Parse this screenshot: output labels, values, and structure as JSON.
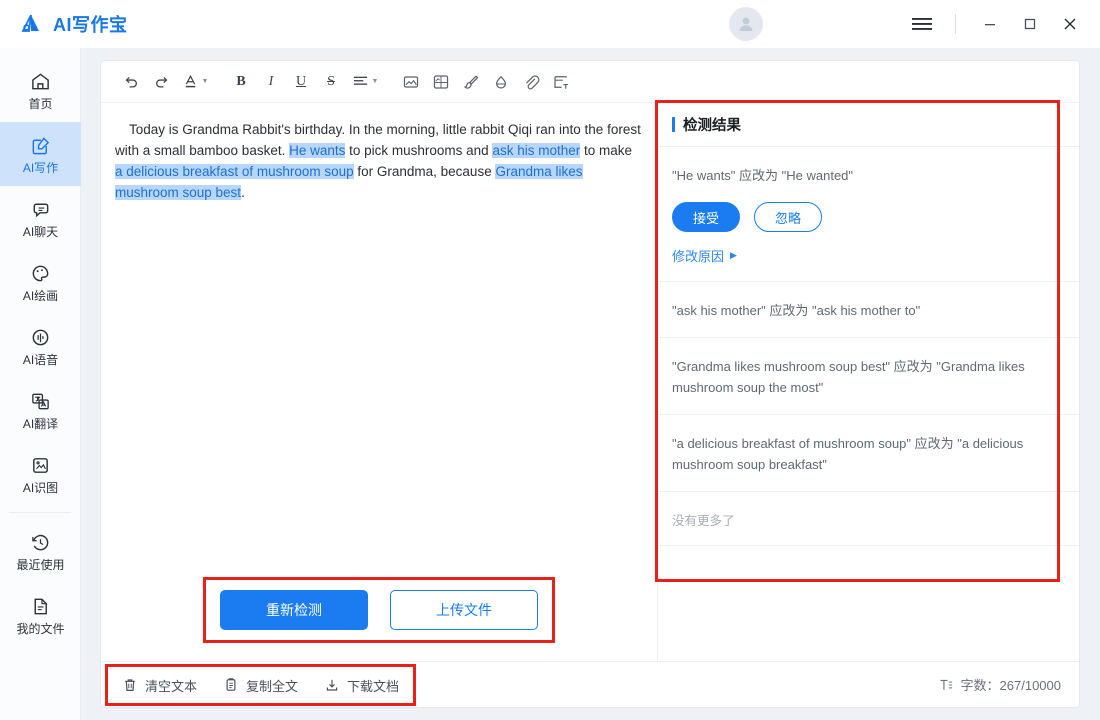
{
  "window": {
    "app_title": "AI写作宝",
    "logo_color": "#1777e8",
    "menu_icon": "hamburger-menu-icon",
    "minimize_label": "—",
    "maximize_label": "□",
    "close_label": "✕"
  },
  "sidebar": {
    "items": [
      {
        "label": "首页",
        "icon": "home-icon",
        "active": false
      },
      {
        "label": "AI写作",
        "icon": "edit-document-icon",
        "active": true
      },
      {
        "label": "AI聊天",
        "icon": "chat-bubble-icon",
        "active": false
      },
      {
        "label": "AI绘画",
        "icon": "palette-icon",
        "active": false
      },
      {
        "label": "AI语音",
        "icon": "audio-wave-icon",
        "active": false
      },
      {
        "label": "AI翻译",
        "icon": "translate-icon",
        "active": false
      },
      {
        "label": "AI识图",
        "icon": "image-recognition-icon",
        "active": false
      }
    ],
    "items_secondary": [
      {
        "label": "最近使用",
        "icon": "history-clock-icon",
        "active": false
      },
      {
        "label": "我的文件",
        "icon": "file-document-icon",
        "active": false
      }
    ]
  },
  "toolbar": {
    "items": [
      {
        "name": "undo-icon",
        "glyph": "↶"
      },
      {
        "name": "redo-icon",
        "glyph": "↷"
      },
      {
        "name": "text-color-icon",
        "glyph": "A"
      },
      {
        "name": "bold-icon",
        "glyph": "B"
      },
      {
        "name": "italic-icon",
        "glyph": "I"
      },
      {
        "name": "underline-icon",
        "glyph": "U"
      },
      {
        "name": "strikethrough-icon",
        "glyph": "S"
      },
      {
        "name": "align-icon",
        "glyph": "≡"
      },
      {
        "name": "insert-image-icon",
        "glyph": "image"
      },
      {
        "name": "image-frame-icon",
        "glyph": "image2"
      },
      {
        "name": "brush-icon",
        "glyph": "brush"
      },
      {
        "name": "ink-drop-icon",
        "glyph": "drop"
      },
      {
        "name": "attachment-icon",
        "glyph": "clip"
      },
      {
        "name": "insert-textbox-icon",
        "glyph": "textbox"
      }
    ]
  },
  "editor": {
    "segments": [
      {
        "text": "Today is Grandma Rabbit's birthday. In the morning, little rabbit Qiqi ran into the forest with a small bamboo basket. ",
        "highlight": false
      },
      {
        "text": "He wants",
        "highlight": true
      },
      {
        "text": " to pick mushrooms and ",
        "highlight": false
      },
      {
        "text": "ask his mother",
        "highlight": true
      },
      {
        "text": " to make ",
        "highlight": false
      },
      {
        "text": "a delicious breakfast of mushroom soup",
        "highlight": true
      },
      {
        "text": " for Grandma, because ",
        "highlight": false
      },
      {
        "text": "Grandma likes mushroom soup best",
        "highlight": true
      },
      {
        "text": ".",
        "highlight": false
      }
    ],
    "highlight_color": "#b6d7fb"
  },
  "actions": {
    "recheck_label": "重新检测",
    "upload_label": "上传文件"
  },
  "panel": {
    "title": "检测结果",
    "accent_color": "#1a7cf0",
    "results": [
      {
        "text": "\"He wants\" 应改为 \"He wanted\"",
        "accept_label": "接受",
        "ignore_label": "忽略",
        "reason_label": "修改原因",
        "has_buttons": true
      },
      {
        "text": "\"ask his mother\" 应改为 \"ask his mother to\"",
        "has_buttons": false
      },
      {
        "text": "\"Grandma likes mushroom soup best\" 应改为 \"Grandma likes mushroom soup the most\"",
        "has_buttons": false
      },
      {
        "text": "\"a delicious breakfast of mushroom soup\" 应改为 \"a delicious mushroom soup breakfast\"",
        "has_buttons": false
      }
    ],
    "end_text": "没有更多了"
  },
  "statusbar": {
    "items": [
      {
        "label": "清空文本",
        "icon": "trash-icon"
      },
      {
        "label": "复制全文",
        "icon": "copy-icon"
      },
      {
        "label": "下载文档",
        "icon": "download-icon"
      }
    ],
    "wordcount_icon": "text-format-icon",
    "wordcount_label": "字数：267/10000"
  }
}
